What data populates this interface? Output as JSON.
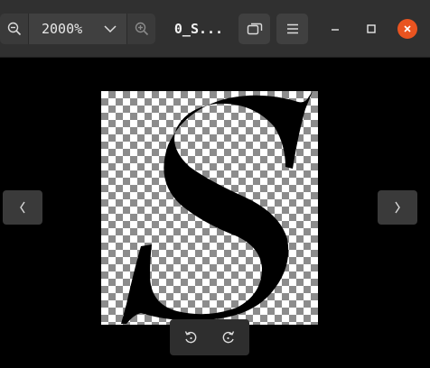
{
  "toolbar": {
    "zoom_level": "2000%",
    "title": "0_S..."
  },
  "icons": {
    "zoom_out": "zoom-out-icon",
    "zoom_dropdown": "chevron-down-icon",
    "zoom_in": "zoom-in-icon",
    "gallery": "gallery-icon",
    "menu": "hamburger-menu-icon",
    "minimize": "minimize-icon",
    "maximize": "maximize-icon",
    "close": "close-icon",
    "previous": "chevron-left-icon",
    "next": "chevron-right-icon",
    "rotate_left": "rotate-left-icon",
    "rotate_right": "rotate-right-icon"
  },
  "colors": {
    "close_button": "#e95420",
    "headerbar": "#303030",
    "viewer_background": "#000000",
    "glyph": "#000000"
  },
  "image": {
    "glyph": "S"
  }
}
